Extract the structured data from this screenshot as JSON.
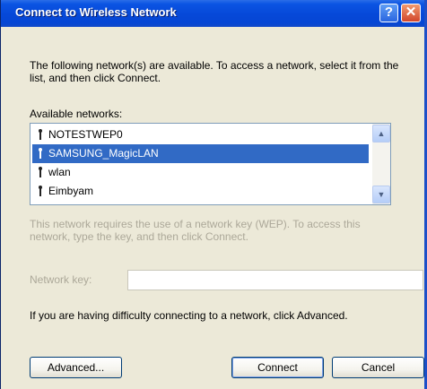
{
  "window": {
    "title": "Connect to Wireless Network",
    "help_label": "?",
    "close_label": "✕"
  },
  "intro_text": "The following network(s) are available. To access a network, select it from the list, and then click Connect.",
  "available_label": "Available networks:",
  "networks": [
    {
      "name": "NOTESTWEP0",
      "selected": false
    },
    {
      "name": "SAMSUNG_MagicLAN",
      "selected": true
    },
    {
      "name": "wlan",
      "selected": false
    },
    {
      "name": "Eimbyam",
      "selected": false
    }
  ],
  "scroll": {
    "up_icon": "▲",
    "down_icon": "▼"
  },
  "wep_note": "This network requires the use of a network key (WEP). To access this network, type the key, and then click Connect.",
  "key_label": "Network key:",
  "key_value": "",
  "advanced_note": "If you are having difficulty connecting to a network, click Advanced.",
  "buttons": {
    "advanced": "Advanced...",
    "connect": "Connect",
    "cancel": "Cancel"
  },
  "icons": {
    "network": "antenna-icon",
    "help": "help-icon",
    "close": "close-icon"
  },
  "colors": {
    "titlebar": "#0648d8",
    "selection": "#316ac5",
    "disabled_text": "#aca899",
    "dialog_bg": "#ece9d8"
  }
}
